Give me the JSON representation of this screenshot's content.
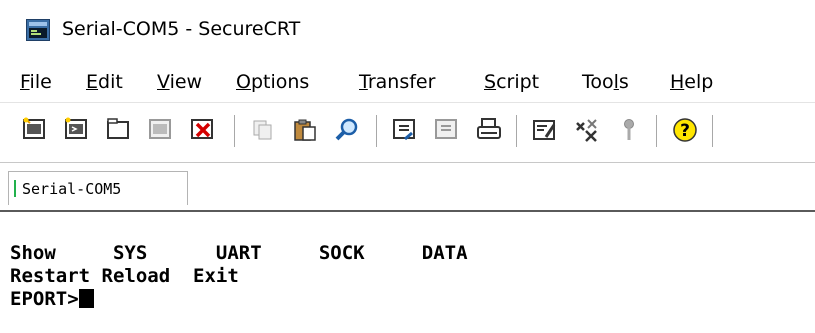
{
  "window": {
    "title": "Serial-COM5 - SecureCRT",
    "icon": "securecrt-app-icon"
  },
  "menu": {
    "items": [
      {
        "label": "File",
        "underline": "F"
      },
      {
        "label": "Edit",
        "underline": "E"
      },
      {
        "label": "View",
        "underline": "V"
      },
      {
        "label": "Options",
        "underline": "O"
      },
      {
        "label": "Transfer",
        "underline": "T"
      },
      {
        "label": "Script",
        "underline": "S"
      },
      {
        "label": "Tools",
        "underline": "l"
      },
      {
        "label": "Help",
        "underline": "H"
      }
    ]
  },
  "toolbar": {
    "buttons": [
      "connect-icon",
      "quick-connect-icon",
      "connect-in-tab-icon",
      "reconnect-icon",
      "disconnect-icon",
      "copy-icon",
      "paste-icon",
      "find-icon",
      "send-file-icon",
      "receive-file-icon",
      "print-icon",
      "session-options-icon",
      "global-options-icon",
      "key-icon",
      "help-icon"
    ]
  },
  "tabs": [
    {
      "label": "Serial-COM5",
      "status_color": "#22b14c"
    }
  ],
  "terminal": {
    "lines": [
      "Show     SYS      UART     SOCK     DATA",
      "Restart Reload  Exit",
      "EPORT>"
    ]
  },
  "colors": {
    "tab_active_indicator": "#22b14c",
    "terminal_background": "#ffffff",
    "terminal_text": "#000000"
  }
}
